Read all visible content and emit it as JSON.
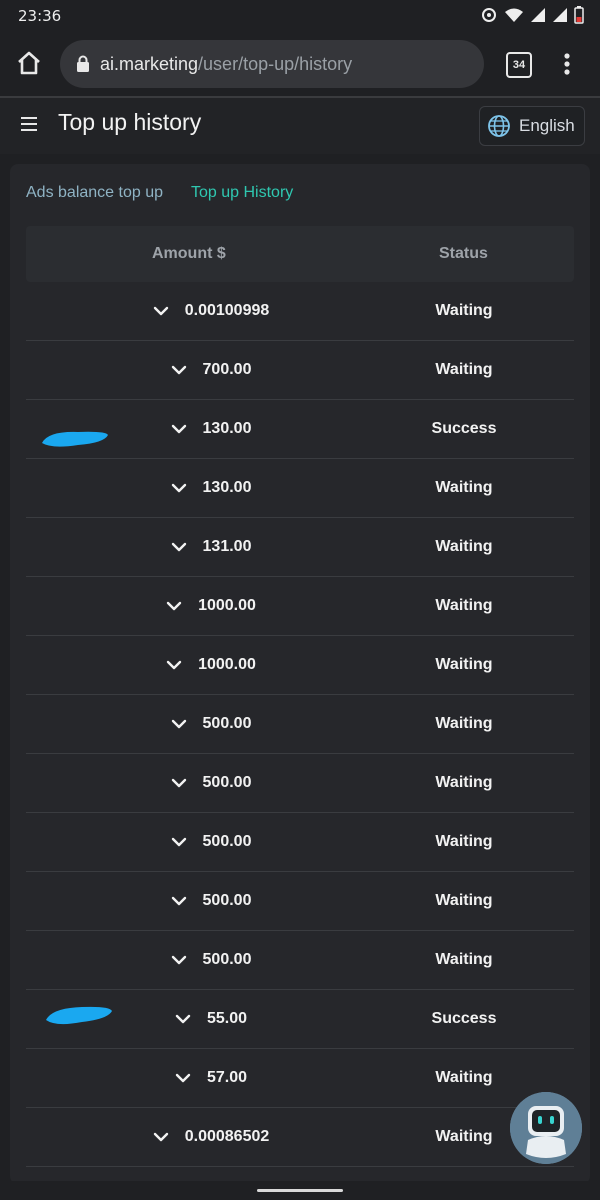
{
  "status_bar": {
    "time": "23:36"
  },
  "browser": {
    "url_domain": "ai.marketing",
    "url_path": "/user/top-up/history",
    "tab_count": "34"
  },
  "header": {
    "title": "Top up history",
    "language": "English"
  },
  "tabs": [
    {
      "label": "Ads balance top up",
      "active": false
    },
    {
      "label": "Top up History",
      "active": true
    }
  ],
  "table": {
    "headers": {
      "amount": "Amount $",
      "status": "Status"
    },
    "rows": [
      {
        "amount": "0.00100998",
        "status": "Waiting"
      },
      {
        "amount": "700.00",
        "status": "Waiting"
      },
      {
        "amount": "130.00",
        "status": "Success"
      },
      {
        "amount": "130.00",
        "status": "Waiting"
      },
      {
        "amount": "131.00",
        "status": "Waiting"
      },
      {
        "amount": "1000.00",
        "status": "Waiting"
      },
      {
        "amount": "1000.00",
        "status": "Waiting"
      },
      {
        "amount": "500.00",
        "status": "Waiting"
      },
      {
        "amount": "500.00",
        "status": "Waiting"
      },
      {
        "amount": "500.00",
        "status": "Waiting"
      },
      {
        "amount": "500.00",
        "status": "Waiting"
      },
      {
        "amount": "500.00",
        "status": "Waiting"
      },
      {
        "amount": "55.00",
        "status": "Success"
      },
      {
        "amount": "57.00",
        "status": "Waiting"
      },
      {
        "amount": "0.00086502",
        "status": "Waiting"
      }
    ]
  },
  "colors": {
    "accent": "#2fc7b0",
    "background": "#1f2023",
    "panel": "#26272b",
    "scribble": "#1aa8f0"
  }
}
